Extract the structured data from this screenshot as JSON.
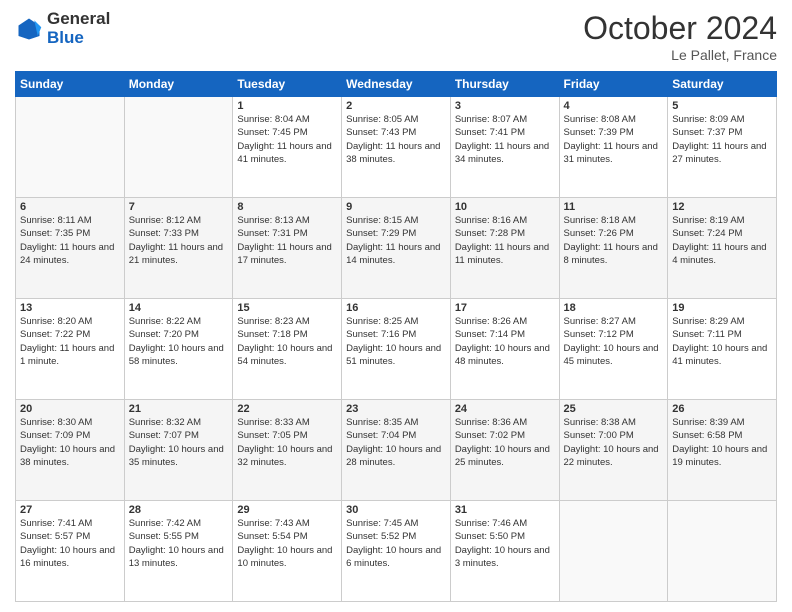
{
  "header": {
    "logo_line1": "General",
    "logo_line2": "Blue",
    "month": "October 2024",
    "location": "Le Pallet, France"
  },
  "weekdays": [
    "Sunday",
    "Monday",
    "Tuesday",
    "Wednesday",
    "Thursday",
    "Friday",
    "Saturday"
  ],
  "weeks": [
    [
      {
        "day": "",
        "sunrise": "",
        "sunset": "",
        "daylight": ""
      },
      {
        "day": "",
        "sunrise": "",
        "sunset": "",
        "daylight": ""
      },
      {
        "day": "1",
        "sunrise": "Sunrise: 8:04 AM",
        "sunset": "Sunset: 7:45 PM",
        "daylight": "Daylight: 11 hours and 41 minutes."
      },
      {
        "day": "2",
        "sunrise": "Sunrise: 8:05 AM",
        "sunset": "Sunset: 7:43 PM",
        "daylight": "Daylight: 11 hours and 38 minutes."
      },
      {
        "day": "3",
        "sunrise": "Sunrise: 8:07 AM",
        "sunset": "Sunset: 7:41 PM",
        "daylight": "Daylight: 11 hours and 34 minutes."
      },
      {
        "day": "4",
        "sunrise": "Sunrise: 8:08 AM",
        "sunset": "Sunset: 7:39 PM",
        "daylight": "Daylight: 11 hours and 31 minutes."
      },
      {
        "day": "5",
        "sunrise": "Sunrise: 8:09 AM",
        "sunset": "Sunset: 7:37 PM",
        "daylight": "Daylight: 11 hours and 27 minutes."
      }
    ],
    [
      {
        "day": "6",
        "sunrise": "Sunrise: 8:11 AM",
        "sunset": "Sunset: 7:35 PM",
        "daylight": "Daylight: 11 hours and 24 minutes."
      },
      {
        "day": "7",
        "sunrise": "Sunrise: 8:12 AM",
        "sunset": "Sunset: 7:33 PM",
        "daylight": "Daylight: 11 hours and 21 minutes."
      },
      {
        "day": "8",
        "sunrise": "Sunrise: 8:13 AM",
        "sunset": "Sunset: 7:31 PM",
        "daylight": "Daylight: 11 hours and 17 minutes."
      },
      {
        "day": "9",
        "sunrise": "Sunrise: 8:15 AM",
        "sunset": "Sunset: 7:29 PM",
        "daylight": "Daylight: 11 hours and 14 minutes."
      },
      {
        "day": "10",
        "sunrise": "Sunrise: 8:16 AM",
        "sunset": "Sunset: 7:28 PM",
        "daylight": "Daylight: 11 hours and 11 minutes."
      },
      {
        "day": "11",
        "sunrise": "Sunrise: 8:18 AM",
        "sunset": "Sunset: 7:26 PM",
        "daylight": "Daylight: 11 hours and 8 minutes."
      },
      {
        "day": "12",
        "sunrise": "Sunrise: 8:19 AM",
        "sunset": "Sunset: 7:24 PM",
        "daylight": "Daylight: 11 hours and 4 minutes."
      }
    ],
    [
      {
        "day": "13",
        "sunrise": "Sunrise: 8:20 AM",
        "sunset": "Sunset: 7:22 PM",
        "daylight": "Daylight: 11 hours and 1 minute."
      },
      {
        "day": "14",
        "sunrise": "Sunrise: 8:22 AM",
        "sunset": "Sunset: 7:20 PM",
        "daylight": "Daylight: 10 hours and 58 minutes."
      },
      {
        "day": "15",
        "sunrise": "Sunrise: 8:23 AM",
        "sunset": "Sunset: 7:18 PM",
        "daylight": "Daylight: 10 hours and 54 minutes."
      },
      {
        "day": "16",
        "sunrise": "Sunrise: 8:25 AM",
        "sunset": "Sunset: 7:16 PM",
        "daylight": "Daylight: 10 hours and 51 minutes."
      },
      {
        "day": "17",
        "sunrise": "Sunrise: 8:26 AM",
        "sunset": "Sunset: 7:14 PM",
        "daylight": "Daylight: 10 hours and 48 minutes."
      },
      {
        "day": "18",
        "sunrise": "Sunrise: 8:27 AM",
        "sunset": "Sunset: 7:12 PM",
        "daylight": "Daylight: 10 hours and 45 minutes."
      },
      {
        "day": "19",
        "sunrise": "Sunrise: 8:29 AM",
        "sunset": "Sunset: 7:11 PM",
        "daylight": "Daylight: 10 hours and 41 minutes."
      }
    ],
    [
      {
        "day": "20",
        "sunrise": "Sunrise: 8:30 AM",
        "sunset": "Sunset: 7:09 PM",
        "daylight": "Daylight: 10 hours and 38 minutes."
      },
      {
        "day": "21",
        "sunrise": "Sunrise: 8:32 AM",
        "sunset": "Sunset: 7:07 PM",
        "daylight": "Daylight: 10 hours and 35 minutes."
      },
      {
        "day": "22",
        "sunrise": "Sunrise: 8:33 AM",
        "sunset": "Sunset: 7:05 PM",
        "daylight": "Daylight: 10 hours and 32 minutes."
      },
      {
        "day": "23",
        "sunrise": "Sunrise: 8:35 AM",
        "sunset": "Sunset: 7:04 PM",
        "daylight": "Daylight: 10 hours and 28 minutes."
      },
      {
        "day": "24",
        "sunrise": "Sunrise: 8:36 AM",
        "sunset": "Sunset: 7:02 PM",
        "daylight": "Daylight: 10 hours and 25 minutes."
      },
      {
        "day": "25",
        "sunrise": "Sunrise: 8:38 AM",
        "sunset": "Sunset: 7:00 PM",
        "daylight": "Daylight: 10 hours and 22 minutes."
      },
      {
        "day": "26",
        "sunrise": "Sunrise: 8:39 AM",
        "sunset": "Sunset: 6:58 PM",
        "daylight": "Daylight: 10 hours and 19 minutes."
      }
    ],
    [
      {
        "day": "27",
        "sunrise": "Sunrise: 7:41 AM",
        "sunset": "Sunset: 5:57 PM",
        "daylight": "Daylight: 10 hours and 16 minutes."
      },
      {
        "day": "28",
        "sunrise": "Sunrise: 7:42 AM",
        "sunset": "Sunset: 5:55 PM",
        "daylight": "Daylight: 10 hours and 13 minutes."
      },
      {
        "day": "29",
        "sunrise": "Sunrise: 7:43 AM",
        "sunset": "Sunset: 5:54 PM",
        "daylight": "Daylight: 10 hours and 10 minutes."
      },
      {
        "day": "30",
        "sunrise": "Sunrise: 7:45 AM",
        "sunset": "Sunset: 5:52 PM",
        "daylight": "Daylight: 10 hours and 6 minutes."
      },
      {
        "day": "31",
        "sunrise": "Sunrise: 7:46 AM",
        "sunset": "Sunset: 5:50 PM",
        "daylight": "Daylight: 10 hours and 3 minutes."
      },
      {
        "day": "",
        "sunrise": "",
        "sunset": "",
        "daylight": ""
      },
      {
        "day": "",
        "sunrise": "",
        "sunset": "",
        "daylight": ""
      }
    ]
  ]
}
